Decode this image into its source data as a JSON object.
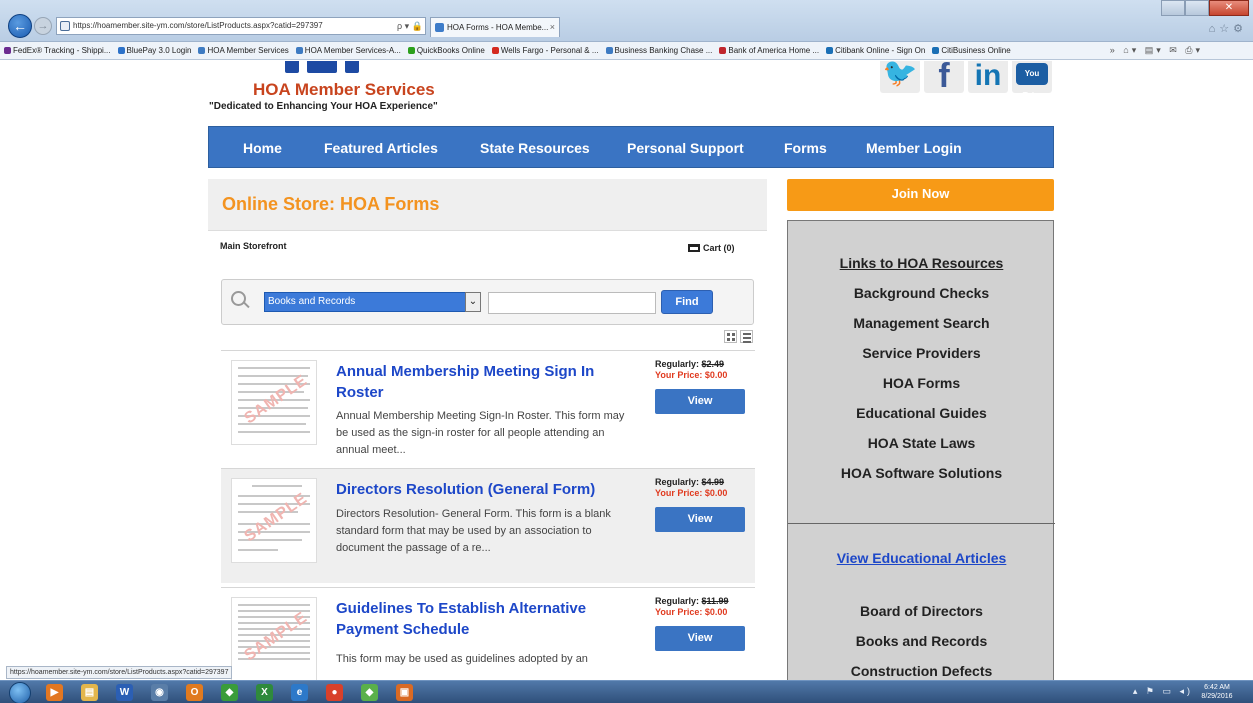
{
  "browser": {
    "url": "https://hoamember.site-ym.com/store/ListProducts.aspx?catid=297397",
    "address_controls": "ρ ▾ 🔒 C",
    "tab_title": "HOA Forms - HOA Membe...",
    "tab_close": "×",
    "close_glyph": "✕",
    "nav_back": "←",
    "nav_forward": "→",
    "toolbar_icons": "⌂☆⚙",
    "favorites_tools": "» ⌂▾ ▤▾ ✉ ⎙▾",
    "favorites": [
      {
        "label": "FedEx® Tracking - Shippi...",
        "color": "#6b2b90"
      },
      {
        "label": "BluePay 3.0 Login",
        "color": "#2d72c9"
      },
      {
        "label": "HOA Member Services",
        "color": "#3e7bc2"
      },
      {
        "label": "HOA Member Services-A...",
        "color": "#3e7bc2"
      },
      {
        "label": "QuickBooks Online",
        "color": "#2ca01c"
      },
      {
        "label": "Wells Fargo - Personal & ...",
        "color": "#d42a20"
      },
      {
        "label": "Business Banking Chase ...",
        "color": "#3e7bc2"
      },
      {
        "label": "Bank of America Home ...",
        "color": "#c0262d"
      },
      {
        "label": "Citibank Online - Sign On",
        "color": "#1a6fb5"
      },
      {
        "label": "CitiBusiness Online",
        "color": "#1a6fb5"
      }
    ],
    "status_url": "https://hoamember.site-ym.com/store/ListProducts.aspx?catid=297397"
  },
  "site": {
    "brand_title": "HOA Member Services",
    "tagline": "\"Dedicated to Enhancing Your HOA Experience\"",
    "social": {
      "twitter": "🐦",
      "facebook": "f",
      "linkedin": "in",
      "youtube": "You Tube"
    },
    "nav": [
      {
        "label": "Home"
      },
      {
        "label": "Featured Articles"
      },
      {
        "label": "State Resources"
      },
      {
        "label": "Personal Support"
      },
      {
        "label": "Forms"
      },
      {
        "label": "Member Login"
      }
    ]
  },
  "store": {
    "title": "Online Store: HOA Forms",
    "storefront_link": "Main Storefront",
    "cart_label": "Cart (0)",
    "category_selected": "Books and Records",
    "select_arrow": "⌄",
    "search_value": "",
    "find_label": "Find",
    "products": [
      {
        "title": "Annual Membership Meeting Sign In Roster",
        "description": "Annual Membership Meeting Sign-In Roster.  This form may be used as the sign-in roster for all people attending an annual meet...",
        "regular_label": "Regularly:",
        "regular_price": "$2.49",
        "your_price": "Your Price: $0.00",
        "view_label": "View",
        "watermark": "SAMPLE"
      },
      {
        "title": "Directors Resolution (General Form)",
        "description": "Directors Resolution- General Form. This form is a blank standard form that may be used by an association to document the passage of a re...",
        "regular_label": "Regularly:",
        "regular_price": "$4.99",
        "your_price": "Your Price: $0.00",
        "view_label": "View",
        "watermark": "SAMPLE"
      },
      {
        "title": "Guidelines To Establish Alternative Payment Schedule",
        "description": "This form may be used as guidelines adopted by an",
        "regular_label": "Regularly:",
        "regular_price": "$11.99",
        "your_price": "Your Price: $0.00",
        "view_label": "View",
        "watermark": "SAMPLE"
      }
    ]
  },
  "sidebar": {
    "join_label": "Join Now",
    "links_heading": "Links to HOA Resources",
    "links": [
      "Background Checks",
      "Management Search",
      "Service Providers",
      "HOA Forms",
      "Educational Guides",
      "HOA State Laws",
      "HOA Software Solutions"
    ],
    "articles_link": "View Educational Articles",
    "topics": [
      "Board of Directors",
      "Books and Records",
      "Construction Defects"
    ]
  },
  "taskbar": {
    "time": "6:42 AM",
    "date": "8/29/2016",
    "tray": "▴ ⚑ ▭ ◂)",
    "apps": [
      {
        "name": "media-player-icon",
        "glyph": "▶",
        "color": "#e27722"
      },
      {
        "name": "file-explorer-icon",
        "glyph": "▤",
        "color": "#e3b64c"
      },
      {
        "name": "word-icon",
        "glyph": "W",
        "color": "#2b5fb4"
      },
      {
        "name": "app-globe-icon",
        "glyph": "◉",
        "color": "#5a7ea8"
      },
      {
        "name": "outlook-icon",
        "glyph": "O",
        "color": "#e07a1f"
      },
      {
        "name": "quickbooks-icon",
        "glyph": "◆",
        "color": "#3a9c3a"
      },
      {
        "name": "excel-icon",
        "glyph": "X",
        "color": "#2f8a3c"
      },
      {
        "name": "internet-explorer-icon",
        "glyph": "e",
        "color": "#2d79c9"
      },
      {
        "name": "chrome-icon",
        "glyph": "●",
        "color": "#d8402a"
      },
      {
        "name": "app-green-icon",
        "glyph": "◆",
        "color": "#5ab04a"
      },
      {
        "name": "app-orange-icon",
        "glyph": "▣",
        "color": "#d96a24"
      }
    ]
  }
}
